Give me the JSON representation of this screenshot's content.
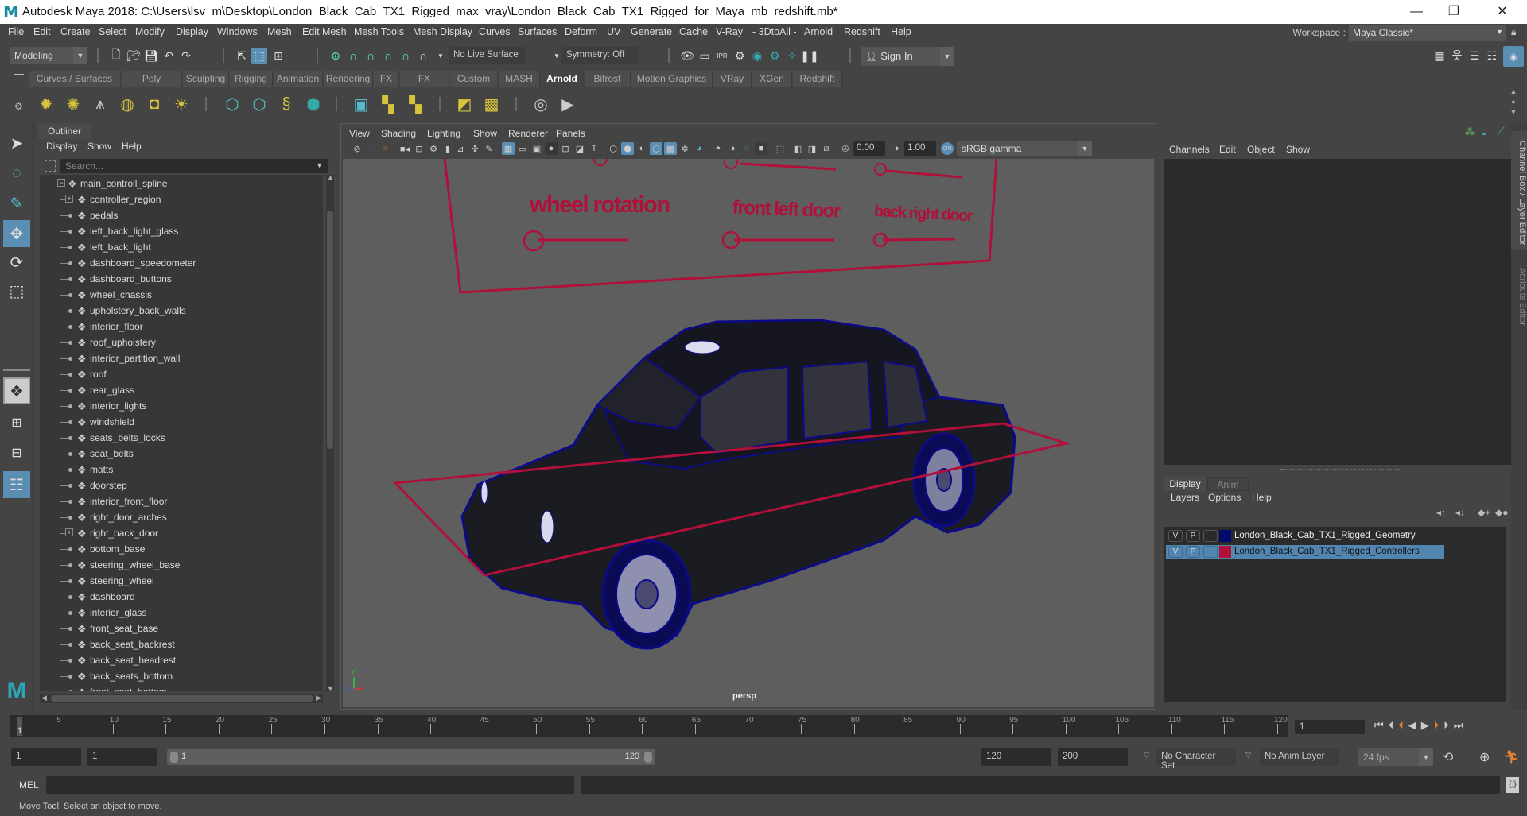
{
  "app": {
    "title": "Autodesk Maya 2018: C:\\Users\\lsv_m\\Desktop\\London_Black_Cab_TX1_Rigged_max_vray\\London_Black_Cab_TX1_Rigged_for_Maya_mb_redshift.mb*",
    "logo": "M",
    "window_controls": {
      "minimize": "—",
      "maximize": "❐",
      "close": "✕"
    }
  },
  "menubar": {
    "items": [
      "File",
      "Edit",
      "Create",
      "Select",
      "Modify",
      "Display",
      "Windows",
      "Mesh",
      "Edit Mesh",
      "Mesh Tools",
      "Mesh Display",
      "Curves",
      "Surfaces",
      "Deform",
      "UV",
      "Generate",
      "Cache",
      "V-Ray",
      "- 3DtoAll -",
      "Arnold",
      "Redshift",
      "Help"
    ],
    "workspace_label": "Workspace :",
    "workspace_value": "Maya Classic*"
  },
  "statusline": {
    "mode": "Modeling",
    "live_surface": "No Live Surface",
    "symmetry": "Symmetry: Off",
    "sign_in": "Sign In"
  },
  "shelf": {
    "tabs": [
      "Curves / Surfaces",
      "Poly Modeling",
      "Sculpting",
      "Rigging",
      "Animation",
      "Rendering",
      "FX",
      "FX Caching",
      "Custom",
      "MASH",
      "Arnold",
      "Bifrost",
      "Motion Graphics",
      "VRay",
      "XGen",
      "Redshift"
    ],
    "active_tab": "Arnold"
  },
  "outliner": {
    "tab": "Outliner",
    "menu": [
      "Display",
      "Show",
      "Help"
    ],
    "search_placeholder": "Search...",
    "root": "main_controll_spline",
    "items": [
      {
        "name": "controller_region",
        "expandable": true
      },
      {
        "name": "pedals",
        "expandable": false
      },
      {
        "name": "left_back_light_glass",
        "expandable": false
      },
      {
        "name": "left_back_light",
        "expandable": false
      },
      {
        "name": "dashboard_speedometer",
        "expandable": false
      },
      {
        "name": "dashboard_buttons",
        "expandable": false
      },
      {
        "name": "wheel_chassis",
        "expandable": false
      },
      {
        "name": "upholstery_back_walls",
        "expandable": false
      },
      {
        "name": "interior_floor",
        "expandable": false
      },
      {
        "name": "roof_upholstery",
        "expandable": false
      },
      {
        "name": "interior_partition_wall",
        "expandable": false
      },
      {
        "name": "roof",
        "expandable": false
      },
      {
        "name": "rear_glass",
        "expandable": false
      },
      {
        "name": "interior_lights",
        "expandable": false
      },
      {
        "name": "windshield",
        "expandable": false
      },
      {
        "name": "seats_belts_locks",
        "expandable": false
      },
      {
        "name": "seat_belts",
        "expandable": false
      },
      {
        "name": "matts",
        "expandable": false
      },
      {
        "name": "doorstep",
        "expandable": false
      },
      {
        "name": "interior_front_floor",
        "expandable": false
      },
      {
        "name": "right_door_arches",
        "expandable": false
      },
      {
        "name": "right_back_door",
        "expandable": true
      },
      {
        "name": "bottom_base",
        "expandable": false
      },
      {
        "name": "steering_wheel_base",
        "expandable": false
      },
      {
        "name": "steering_wheel",
        "expandable": false
      },
      {
        "name": "dashboard",
        "expandable": false
      },
      {
        "name": "interior_glass",
        "expandable": false
      },
      {
        "name": "front_seat_base",
        "expandable": false
      },
      {
        "name": "back_seat_backrest",
        "expandable": false
      },
      {
        "name": "back_seat_headrest",
        "expandable": false
      },
      {
        "name": "back_seats_bottom",
        "expandable": false
      },
      {
        "name": "front_seat_bottom",
        "expandable": false
      }
    ]
  },
  "viewport": {
    "menu": [
      "View",
      "Shading",
      "Lighting",
      "Show",
      "Renderer",
      "Panels"
    ],
    "exposure": "0.00",
    "gamma": "1.00",
    "color_space": "sRGB gamma",
    "camera": "persp",
    "controller_labels": [
      "wheel rotation",
      "front left door",
      "back right door"
    ],
    "axis_labels": {
      "y": "y",
      "z": "z",
      "x": "x"
    }
  },
  "channel_box": {
    "menu": [
      "Channels",
      "Edit",
      "Object",
      "Show"
    ]
  },
  "side_tabs": [
    "Channel Box / Layer Editor",
    "Attribute Editor"
  ],
  "layer_editor": {
    "tabs": [
      "Display",
      "Anim"
    ],
    "active_tab": "Display",
    "menu": [
      "Layers",
      "Options",
      "Help"
    ],
    "layers": [
      {
        "v": "V",
        "p": "P",
        "color": "#000a6e",
        "name": "London_Black_Cab_TX1_Rigged_Geometry",
        "selected": false
      },
      {
        "v": "V",
        "p": "P",
        "color": "#b0103a",
        "name": "London_Black_Cab_TX1_Rigged_Controllers",
        "selected": true
      }
    ]
  },
  "timeline": {
    "start": 1,
    "end": 120,
    "current_frame": "1",
    "ticks": [
      5,
      10,
      15,
      20,
      25,
      30,
      35,
      40,
      45,
      50,
      55,
      60,
      65,
      70,
      75,
      80,
      85,
      90,
      95,
      100,
      105,
      110,
      115,
      120
    ],
    "current_label": "1"
  },
  "range": {
    "start_time": "1",
    "playback_start": "1",
    "slider_start": "1",
    "slider_end": "120",
    "playback_end": "120",
    "end_time": "200",
    "character_set": "No Character Set",
    "anim_layer": "No Anim Layer",
    "fps": "24 fps"
  },
  "command_line": {
    "label": "MEL"
  },
  "help_line": "Move Tool: Select an object to move.",
  "colors": {
    "accent": "#5a8fb3",
    "controller": "#b0103a",
    "wireframe": "#0b0b8a"
  }
}
